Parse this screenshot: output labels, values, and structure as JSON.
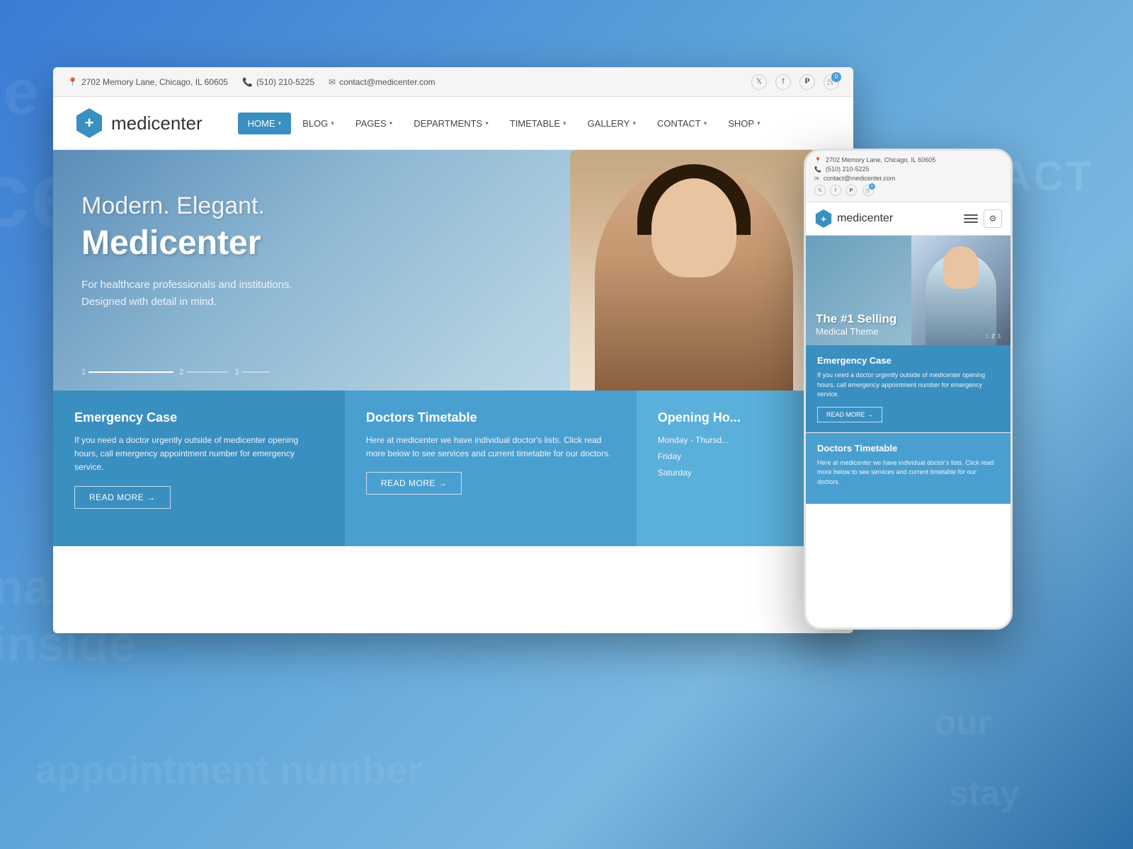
{
  "background": {
    "color": "#4a90c4"
  },
  "contact_badge": "CONTACT",
  "browser": {
    "top_bar": {
      "address": "2702 Memory Lane, Chicago, IL 60605",
      "phone": "(510) 210-5225",
      "email": "contact@medicenter.com",
      "social": [
        "𝕏",
        "f",
        "𝗣"
      ],
      "cart_count": "0"
    },
    "nav": {
      "logo_symbol": "+",
      "logo_text": "medicenter",
      "menu_items": [
        {
          "label": "HOME",
          "active": true
        },
        {
          "label": "BLOG",
          "has_chevron": true
        },
        {
          "label": "PAGES",
          "has_chevron": true
        },
        {
          "label": "DEPARTMENTS",
          "has_chevron": true
        },
        {
          "label": "TIMETABLE",
          "has_chevron": true
        },
        {
          "label": "GALLERY",
          "has_chevron": true
        },
        {
          "label": "CONTACT",
          "has_chevron": true
        },
        {
          "label": "SHOP",
          "has_chevron": true
        }
      ]
    },
    "hero": {
      "subtitle": "Modern. Elegant.",
      "title": "Medicenter",
      "description_line1": "For healthcare professionals and institutions.",
      "description_line2": "Designed with detail in mind.",
      "indicators": [
        "1",
        "2",
        "3"
      ]
    },
    "cards": [
      {
        "title": "Emergency Case",
        "text": "If you need a doctor urgently outside of medicenter opening hours, call emergency appointment number for emergency service.",
        "btn_label": "READ MORE  →"
      },
      {
        "title": "Doctors Timetable",
        "text": "Here at medicenter we have individual doctor's lists. Click read more below to see services and current timetable for our doctors.",
        "btn_label": "READ MORE  →"
      },
      {
        "title": "Opening Ho...",
        "rows": [
          "Monday - Thursd...",
          "Friday",
          "Saturday"
        ]
      }
    ]
  },
  "mobile": {
    "top_bar": {
      "address": "2702 Memory Lane, Chicago, IL 60605",
      "phone": "(510) 210-5225",
      "email": "contact@medicenter.com",
      "social": [
        "𝕏",
        "f",
        "𝗣"
      ],
      "cart_count": "0"
    },
    "nav": {
      "logo_symbol": "+",
      "logo_text": "medicenter"
    },
    "hero": {
      "title": "The #1 Selling",
      "subtitle": "Medical Theme",
      "indicator_active": "2",
      "indicators": [
        "1",
        "2",
        "3"
      ]
    },
    "cards": [
      {
        "title": "Emergency Case",
        "text": "If you need a doctor urgently outside of medicenter opening hours, call emergency appointment number for emergency service.",
        "btn_label": "READ MORE →"
      },
      {
        "title": "Doctors Timetable",
        "text": "Here at medicenter we have individual doctor's lists. Click read more below to see services and current timetable for our doctors.",
        "btn_label": "READ MORE →"
      }
    ]
  }
}
